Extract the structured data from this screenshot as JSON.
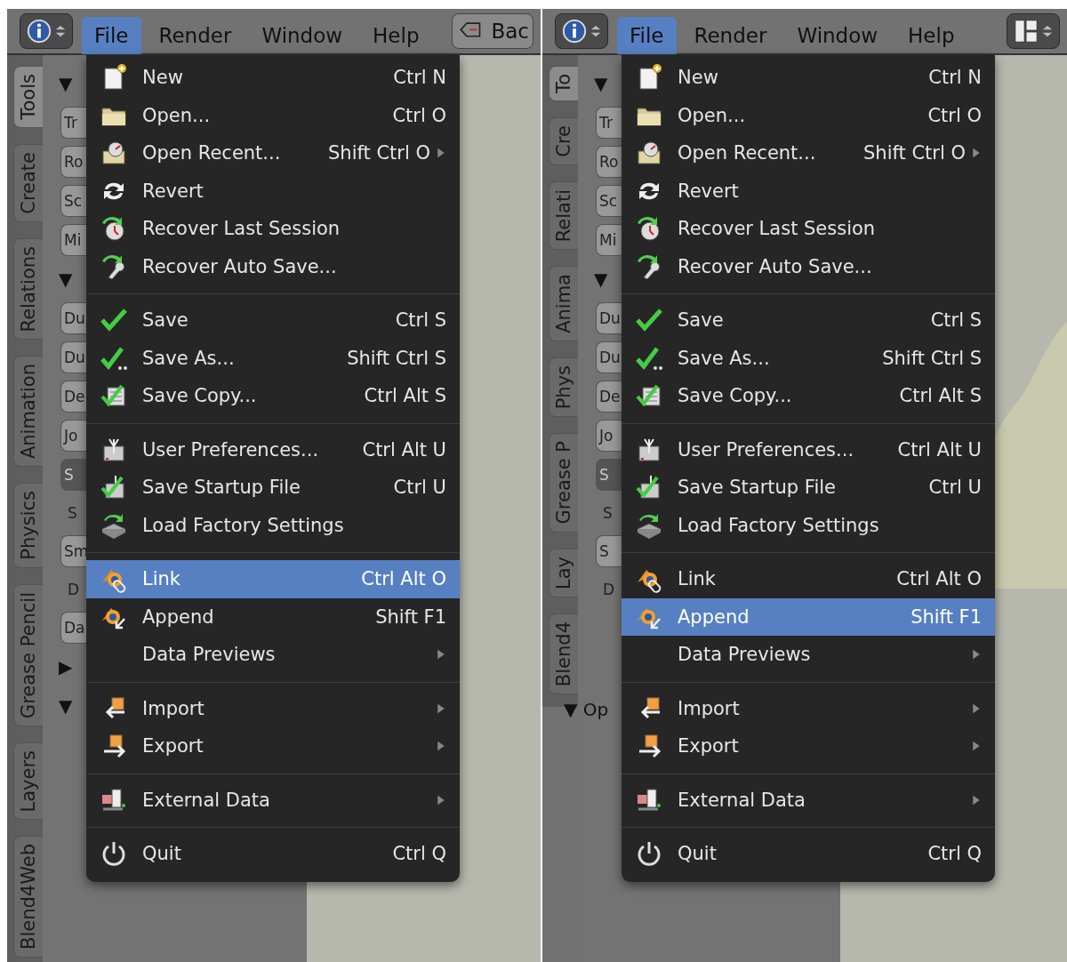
{
  "panels": [
    {
      "header": {
        "info_button": {
          "kind": "info"
        },
        "menus": [
          {
            "label": "File",
            "selected": true
          },
          {
            "label": "Render",
            "selected": false
          },
          {
            "label": "Window",
            "selected": false
          },
          {
            "label": "Help",
            "selected": false
          }
        ],
        "right_button": {
          "kind": "back",
          "label": "Bac"
        }
      },
      "tabs": [
        {
          "label": "Tools",
          "selected": true
        },
        {
          "label": "Create",
          "selected": false
        },
        {
          "label": "Relations",
          "selected": false
        },
        {
          "label": "Animation",
          "selected": false
        },
        {
          "label": "Physics",
          "selected": false
        },
        {
          "label": "Grease Pencil",
          "selected": false
        },
        {
          "label": "Layers",
          "selected": false
        },
        {
          "label": "Blend4Web",
          "selected": false
        }
      ],
      "shelf": [
        {
          "kind": "header",
          "label": "▼"
        },
        {
          "kind": "button",
          "label": "Tr"
        },
        {
          "kind": "button",
          "label": "Ro"
        },
        {
          "kind": "button",
          "label": "Sc"
        },
        {
          "kind": "button",
          "label": "Mi"
        },
        {
          "kind": "header",
          "label": "▼"
        },
        {
          "kind": "button",
          "label": "Du"
        },
        {
          "kind": "button",
          "label": "Du"
        },
        {
          "kind": "button",
          "label": "De"
        },
        {
          "kind": "button",
          "label": "Jo"
        },
        {
          "kind": "dropdown",
          "label": "S"
        },
        {
          "kind": "text",
          "label": "S"
        },
        {
          "kind": "button",
          "label": "Sm"
        },
        {
          "kind": "text",
          "label": "D"
        },
        {
          "kind": "button",
          "label": "Da"
        },
        {
          "kind": "header",
          "label": "▶"
        },
        {
          "kind": "header",
          "label": "▼"
        }
      ],
      "menu": [
        [
          {
            "label": "New",
            "shortcut": "Ctrl N",
            "submenu": false,
            "selected": false
          },
          {
            "label": "Open...",
            "shortcut": "Ctrl O",
            "submenu": false,
            "selected": false
          },
          {
            "label": "Open Recent...",
            "shortcut": "Shift Ctrl O",
            "submenu": true,
            "selected": false
          },
          {
            "label": "Revert",
            "submenu": false,
            "selected": false
          },
          {
            "label": "Recover Last Session",
            "submenu": false,
            "selected": false
          },
          {
            "label": "Recover Auto Save...",
            "submenu": false,
            "selected": false
          }
        ],
        [
          {
            "label": "Save",
            "shortcut": "Ctrl S",
            "submenu": false,
            "selected": false
          },
          {
            "label": "Save As...",
            "shortcut": "Shift Ctrl S",
            "submenu": false,
            "selected": false
          },
          {
            "label": "Save Copy...",
            "shortcut": "Ctrl Alt S",
            "submenu": false,
            "selected": false
          }
        ],
        [
          {
            "label": "User Preferences...",
            "shortcut": "Ctrl Alt U",
            "submenu": false,
            "selected": false
          },
          {
            "label": "Save Startup File",
            "shortcut": "Ctrl U",
            "submenu": false,
            "selected": false
          },
          {
            "label": "Load Factory Settings",
            "submenu": false,
            "selected": false
          }
        ],
        [
          {
            "label": "Link",
            "shortcut": "Ctrl Alt O",
            "submenu": false,
            "selected": true
          },
          {
            "label": "Append",
            "shortcut": "Shift F1",
            "submenu": false,
            "selected": false
          },
          {
            "label": "Data Previews",
            "submenu": true,
            "selected": false
          }
        ],
        [
          {
            "label": "Import",
            "submenu": true,
            "selected": false
          },
          {
            "label": "Export",
            "submenu": true,
            "selected": false
          }
        ],
        [
          {
            "label": "External Data",
            "submenu": true,
            "selected": false
          }
        ],
        [
          {
            "label": "Quit",
            "shortcut": "Ctrl Q",
            "submenu": false,
            "selected": false
          }
        ]
      ]
    },
    {
      "header": {
        "info_button": {
          "kind": "info"
        },
        "menus": [
          {
            "label": "File",
            "selected": true
          },
          {
            "label": "Render",
            "selected": false
          },
          {
            "label": "Window",
            "selected": false
          },
          {
            "label": "Help",
            "selected": false
          }
        ],
        "right_button": {
          "kind": "layout"
        }
      },
      "tabs": [
        {
          "label": "To",
          "selected": true
        },
        {
          "label": "Cre",
          "selected": false
        },
        {
          "label": "Relati",
          "selected": false
        },
        {
          "label": "Anima",
          "selected": false
        },
        {
          "label": "Phys",
          "selected": false
        },
        {
          "label": "Grease P",
          "selected": false
        },
        {
          "label": "Lay",
          "selected": false
        },
        {
          "label": "Blend4",
          "selected": false
        }
      ],
      "shelf": [
        {
          "kind": "header",
          "label": "▼"
        },
        {
          "kind": "button",
          "label": "Tr"
        },
        {
          "kind": "button",
          "label": "Ro"
        },
        {
          "kind": "button",
          "label": "Sc"
        },
        {
          "kind": "button",
          "label": "Mi"
        },
        {
          "kind": "header",
          "label": "▼"
        },
        {
          "kind": "button",
          "label": "Du"
        },
        {
          "kind": "button",
          "label": "Du"
        },
        {
          "kind": "button",
          "label": "De"
        },
        {
          "kind": "button",
          "label": "Jo"
        },
        {
          "kind": "dropdown",
          "label": "S"
        },
        {
          "kind": "text",
          "label": "S"
        },
        {
          "kind": "button",
          "label": "S"
        },
        {
          "kind": "text",
          "label": "D"
        },
        {
          "kind": "spacer"
        },
        {
          "kind": "header",
          "label": "▼ Op"
        }
      ],
      "menu": [
        [
          {
            "label": "New",
            "shortcut": "Ctrl N",
            "submenu": false,
            "selected": false
          },
          {
            "label": "Open...",
            "shortcut": "Ctrl O",
            "submenu": false,
            "selected": false
          },
          {
            "label": "Open Recent...",
            "shortcut": "Shift Ctrl O",
            "submenu": true,
            "selected": false
          },
          {
            "label": "Revert",
            "submenu": false,
            "selected": false
          },
          {
            "label": "Recover Last Session",
            "submenu": false,
            "selected": false
          },
          {
            "label": "Recover Auto Save...",
            "submenu": false,
            "selected": false
          }
        ],
        [
          {
            "label": "Save",
            "shortcut": "Ctrl S",
            "submenu": false,
            "selected": false
          },
          {
            "label": "Save As...",
            "shortcut": "Shift Ctrl S",
            "submenu": false,
            "selected": false
          },
          {
            "label": "Save Copy...",
            "shortcut": "Ctrl Alt S",
            "submenu": false,
            "selected": false
          }
        ],
        [
          {
            "label": "User Preferences...",
            "shortcut": "Ctrl Alt U",
            "submenu": false,
            "selected": false
          },
          {
            "label": "Save Startup File",
            "shortcut": "Ctrl U",
            "submenu": false,
            "selected": false
          },
          {
            "label": "Load Factory Settings",
            "submenu": false,
            "selected": false
          }
        ],
        [
          {
            "label": "Link",
            "shortcut": "Ctrl Alt O",
            "submenu": false,
            "selected": false
          },
          {
            "label": "Append",
            "shortcut": "Shift F1",
            "submenu": false,
            "selected": true
          },
          {
            "label": "Data Previews",
            "submenu": true,
            "selected": false
          }
        ],
        [
          {
            "label": "Import",
            "submenu": true,
            "selected": false
          },
          {
            "label": "Export",
            "submenu": true,
            "selected": false
          }
        ],
        [
          {
            "label": "External Data",
            "submenu": true,
            "selected": false
          }
        ],
        [
          {
            "label": "Quit",
            "shortcut": "Ctrl Q",
            "submenu": false,
            "selected": false
          }
        ]
      ]
    }
  ]
}
